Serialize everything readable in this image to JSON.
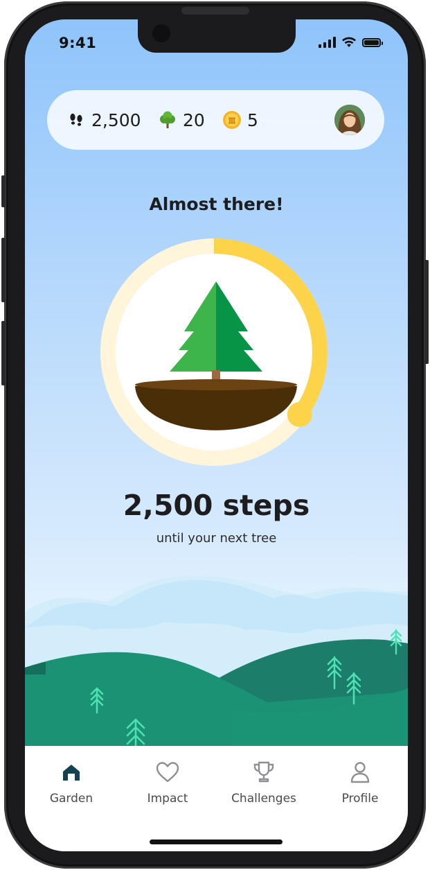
{
  "status_bar": {
    "time": "9:41"
  },
  "stats": {
    "steps": {
      "value": "2,500",
      "icon": "footprints-icon"
    },
    "trees": {
      "value": "20",
      "icon": "tree-icon"
    },
    "coins": {
      "value": "5",
      "icon": "coin-icon"
    },
    "avatar_icon": "user-avatar"
  },
  "main": {
    "headline": "Almost there!",
    "progress": 0.35,
    "steps_remaining": "2,500 steps",
    "steps_caption": "until your next tree"
  },
  "tabbar": {
    "items": [
      {
        "label": "Garden",
        "icon": "home-icon",
        "active": true
      },
      {
        "label": "Impact",
        "icon": "heart-icon",
        "active": false
      },
      {
        "label": "Challenges",
        "icon": "trophy-icon",
        "active": false
      },
      {
        "label": "Profile",
        "icon": "person-icon",
        "active": false
      }
    ]
  },
  "colors": {
    "progress_ring": "#fdd449",
    "progress_track": "#fff6dd",
    "tree_light": "#3db54a",
    "tree_dark": "#079447",
    "soil": "#4a2e08",
    "hills": "#1b9274",
    "active_tab": "#134250"
  }
}
